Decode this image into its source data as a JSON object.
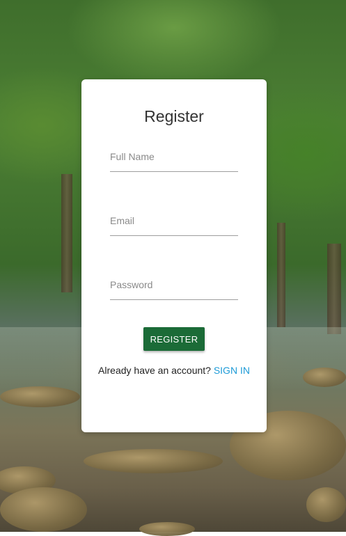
{
  "form": {
    "title": "Register",
    "fields": {
      "full_name": {
        "placeholder": "Full Name",
        "value": ""
      },
      "email": {
        "placeholder": "Email",
        "value": ""
      },
      "password": {
        "placeholder": "Password",
        "value": ""
      }
    },
    "submit_label": "REGISTER",
    "footer_text": "Already have an account?",
    "sign_in_link": "SIGN IN"
  },
  "colors": {
    "button": "#1b6b37",
    "link": "#1e9bd7",
    "card": "#ffffff"
  }
}
